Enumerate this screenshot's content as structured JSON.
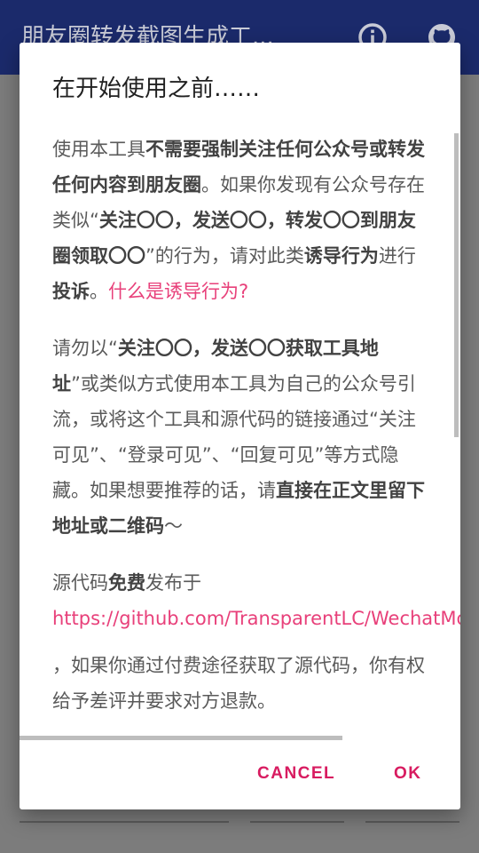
{
  "appbar": {
    "title": "朋友圈转发截图生成工...",
    "icons": [
      "info-icon",
      "github-icon"
    ]
  },
  "dialog": {
    "title": "在开始使用之前……",
    "p1": {
      "t1": "使用本工具",
      "b1": "不需要强制关注任何公众号或转发任何内容到朋友圈",
      "t2": "。如果你发现有公众号存在类似“",
      "b2": "关注〇〇，发送〇〇，转发〇〇到朋友圈领取〇〇",
      "t3": "”的行为，请对此类",
      "b3": "诱导行为",
      "t4": "进行",
      "b4": "投诉",
      "t5": "。",
      "link": "什么是诱导行为?"
    },
    "p2": {
      "t1": "请勿以“",
      "b1": "关注〇〇，发送〇〇获取工具地址",
      "t2": "”或类似方式使用本工具为自己的公众号引流，或将这个工具和源代码的链接通过“关注可见”、“登录可见”、“回复可见”等方式隐藏。如果想要推荐的话，请",
      "b2": "直接在正文里留下地址或二维码",
      "t3": "～"
    },
    "p3": {
      "t1": "源代码",
      "b1": "免费",
      "t2": "发布于",
      "url": "https://github.com/TransparentLC/WechatMo",
      "t3": "，如果你通过付费途径获取了源代码，你有权给予差评并要求对方退款。"
    },
    "buttons": {
      "cancel": "CANCEL",
      "ok": "OK"
    },
    "accent_color": "#d81b60",
    "link_color": "#e8407a"
  }
}
